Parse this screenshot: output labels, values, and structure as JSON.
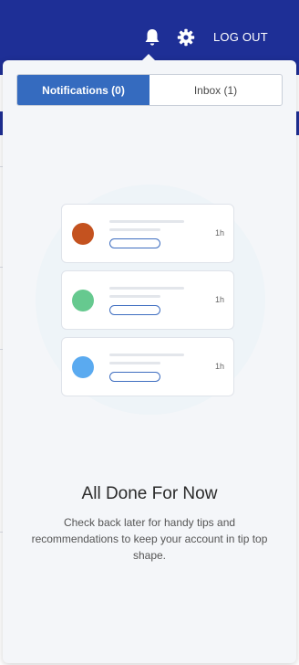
{
  "header": {
    "logout_label": "LOG OUT",
    "bell_icon": "bell-icon",
    "gear_icon": "gear-icon",
    "background_color": "#1e2f96"
  },
  "panel": {
    "tabs": [
      {
        "label": "Notifications (0)",
        "active": true
      },
      {
        "label": "Inbox (1)",
        "active": false
      }
    ],
    "illustration": {
      "cards": [
        {
          "time": "1h",
          "dot_color": "#c4521f"
        },
        {
          "time": "1h",
          "dot_color": "#66c98f"
        },
        {
          "time": "1h",
          "dot_color": "#5aaaf0"
        }
      ]
    },
    "empty_state": {
      "title": "All Done For Now",
      "description": "Check back later for handy tips and recommendations to keep your account in tip top shape."
    },
    "accent_color": "#356bbf"
  }
}
